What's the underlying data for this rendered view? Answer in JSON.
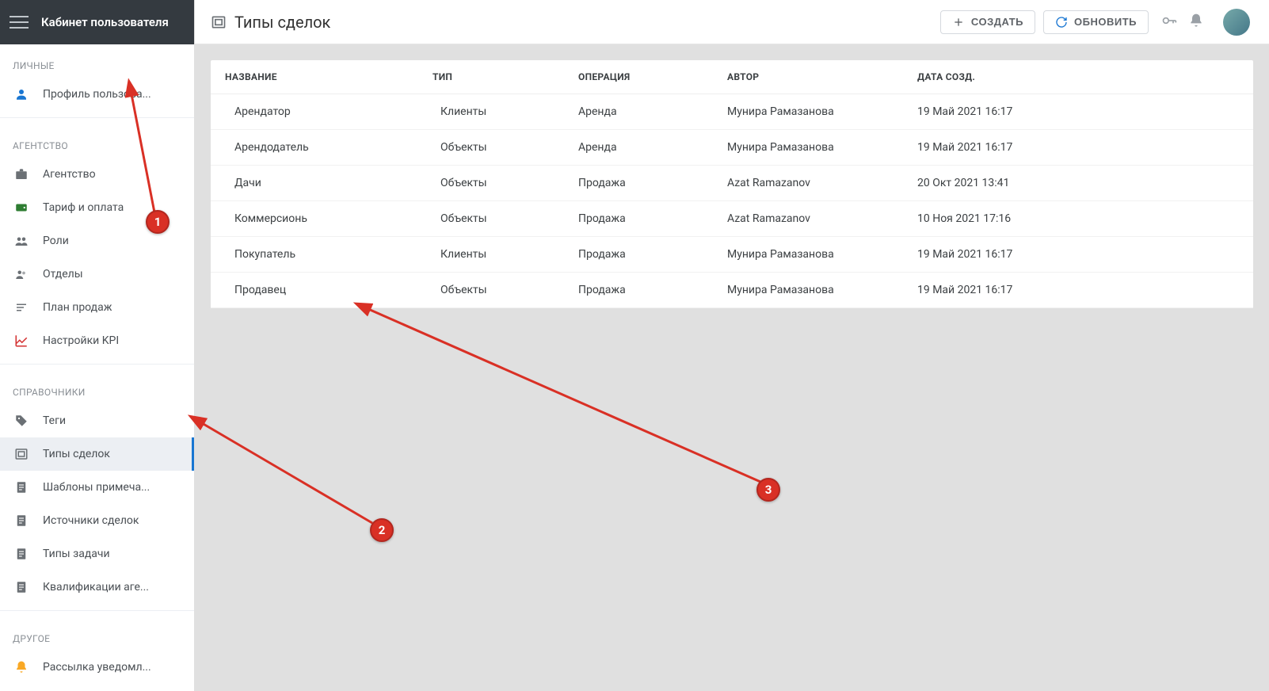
{
  "sidebar": {
    "title": "Кабинет пользователя",
    "sections": [
      {
        "label": "ЛИЧНЫЕ",
        "items": [
          {
            "name": "profile",
            "label": "Профиль пользова...",
            "icon": "person",
            "color": "#1976d2"
          }
        ]
      },
      {
        "label": "АГЕНТСТВО",
        "items": [
          {
            "name": "agency",
            "label": "Агентство",
            "icon": "briefcase"
          },
          {
            "name": "tariff",
            "label": "Тариф и оплата",
            "icon": "wallet",
            "color": "#2e7d32"
          },
          {
            "name": "roles",
            "label": "Роли",
            "icon": "group"
          },
          {
            "name": "departments",
            "label": "Отделы",
            "icon": "people"
          },
          {
            "name": "sales-plan",
            "label": "План продаж",
            "icon": "plan"
          },
          {
            "name": "kpi",
            "label": "Настройки KPI",
            "icon": "chart",
            "color": "#d32f2f"
          }
        ]
      },
      {
        "label": "СПРАВОЧНИКИ",
        "items": [
          {
            "name": "tags",
            "label": "Теги",
            "icon": "tag"
          },
          {
            "name": "deal-types",
            "label": "Типы сделок",
            "icon": "deal",
            "active": true
          },
          {
            "name": "note-templates",
            "label": "Шаблоны примеча...",
            "icon": "doc"
          },
          {
            "name": "deal-sources",
            "label": "Источники сделок",
            "icon": "doc"
          },
          {
            "name": "task-types",
            "label": "Типы задачи",
            "icon": "doc"
          },
          {
            "name": "agent-qualifications",
            "label": "Квалификации аге...",
            "icon": "doc"
          }
        ]
      },
      {
        "label": "ДРУГОЕ",
        "items": [
          {
            "name": "notifications",
            "label": "Рассылка уведомл...",
            "icon": "bell",
            "color": "#f9a825"
          }
        ]
      }
    ]
  },
  "topbar": {
    "title": "Типы сделок",
    "create": "СОЗДАТЬ",
    "refresh": "ОБНОВИТЬ"
  },
  "table": {
    "headers": {
      "name": "НАЗВАНИЕ",
      "type": "ТИП",
      "operation": "ОПЕРАЦИЯ",
      "author": "АВТОР",
      "created": "ДАТА СОЗД."
    },
    "type_clients": "Клиенты",
    "type_objects": "Объекты",
    "rows": [
      {
        "name": "Арендатор",
        "type": "clients",
        "op": "Аренда",
        "author": "Мунира Рамазанова",
        "created": "19 Май 2021 16:17"
      },
      {
        "name": "Арендодатель",
        "type": "objects",
        "op": "Аренда",
        "author": "Мунира Рамазанова",
        "created": "19 Май 2021 16:17"
      },
      {
        "name": "Дачи",
        "type": "objects",
        "op": "Продажа",
        "author": "Azat Ramazanov",
        "created": "20 Окт 2021 13:41"
      },
      {
        "name": "Коммерсионь",
        "type": "objects",
        "op": "Продажа",
        "author": "Azat Ramazanov",
        "created": "10 Ноя 2021 17:16"
      },
      {
        "name": "Покупатель",
        "type": "clients",
        "op": "Продажа",
        "author": "Мунира Рамазанова",
        "created": "19 Май 2021 16:17"
      },
      {
        "name": "Продавец",
        "type": "objects",
        "op": "Продажа",
        "author": "Мунира Рамазанова",
        "created": "19 Май 2021 16:17"
      }
    ]
  },
  "annotations": {
    "m1": "1",
    "m2": "2",
    "m3": "3"
  }
}
